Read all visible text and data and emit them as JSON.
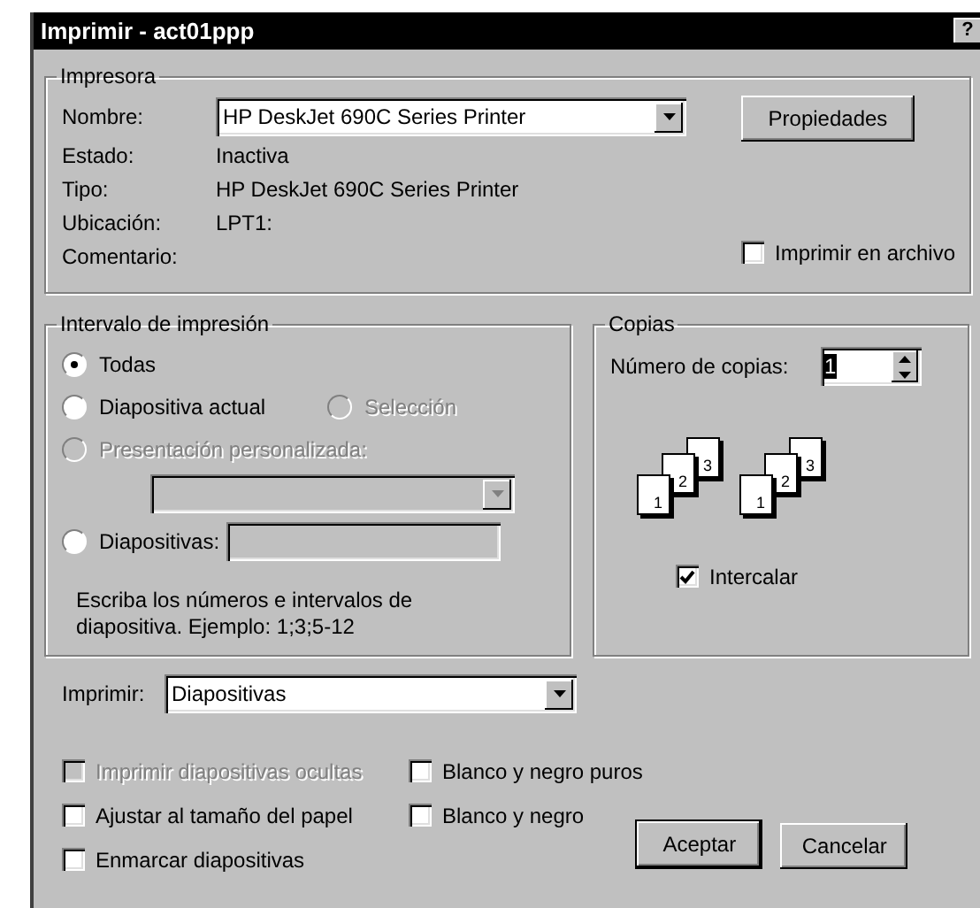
{
  "window": {
    "title": "Imprimir - act01ppp",
    "title_buttons": [
      "?"
    ]
  },
  "printer": {
    "legend": "Impresora",
    "name_label": "Nombre:",
    "name_value": "HP DeskJet 690C Series Printer",
    "properties_button": "Propiedades",
    "info": [
      {
        "label": "Estado:",
        "value": "Inactiva"
      },
      {
        "label": "Tipo:",
        "value": "HP DeskJet 690C Series Printer"
      },
      {
        "label": "Ubicación:",
        "value": "LPT1:"
      },
      {
        "label": "Comentario:"
      }
    ],
    "print_to_file": {
      "label": "Imprimir en archivo",
      "checked": false
    }
  },
  "range": {
    "legend": "Intervalo de impresión",
    "all": {
      "label": "Todas",
      "selected": true,
      "disabled": false
    },
    "current": {
      "label": "Diapositiva actual",
      "selected": false,
      "disabled": false
    },
    "selection": {
      "label": "Selección",
      "selected": false,
      "disabled": true
    },
    "custom": {
      "label": "Presentación personalizada:",
      "selected": false,
      "disabled": true
    },
    "slides": {
      "label": "Diapositivas:",
      "selected": false,
      "disabled": false
    },
    "hint": "Escriba los números e intervalos de diapositiva. Ejemplo: 1;3;5-12"
  },
  "copies": {
    "legend": "Copias",
    "count_label": "Número de copias:",
    "count_value": "1",
    "stacks": [
      [
        "1",
        "2",
        "3"
      ],
      [
        "1",
        "2",
        "3"
      ]
    ],
    "collate": {
      "label": "Intercalar",
      "checked": true
    }
  },
  "print_what": {
    "label": "Imprimir:",
    "value": "Diapositivas"
  },
  "options": [
    {
      "label": "Imprimir diapositivas ocultas",
      "checked": false,
      "disabled": true
    },
    {
      "label": "Blanco y negro puros",
      "checked": false,
      "disabled": false
    },
    {
      "label": "Ajustar al tamaño del papel",
      "checked": false,
      "disabled": false
    },
    {
      "label": "Blanco y negro",
      "checked": false,
      "disabled": false
    },
    {
      "label": "Enmarcar diapositivas",
      "checked": false,
      "disabled": false
    }
  ],
  "buttons": [
    {
      "label": "Aceptar",
      "default": true
    },
    {
      "label": "Cancelar",
      "default": false
    }
  ]
}
